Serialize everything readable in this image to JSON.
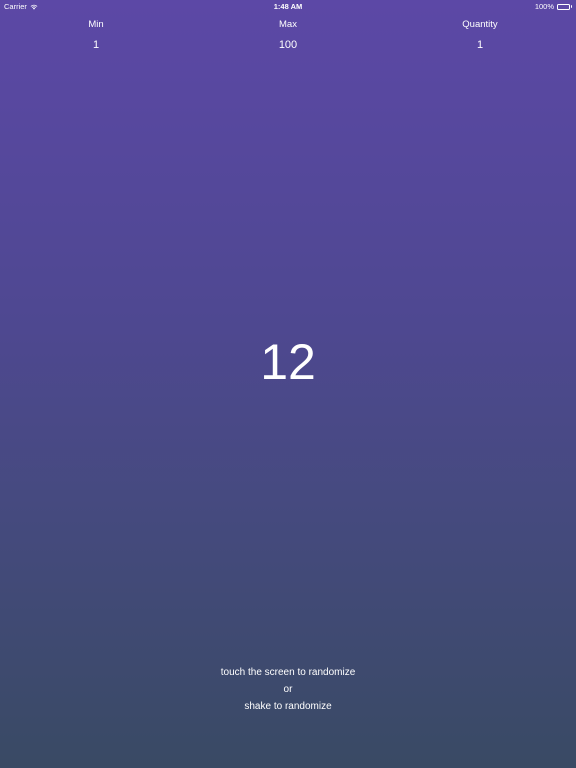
{
  "status_bar": {
    "carrier": "Carrier",
    "time": "1:48 AM",
    "battery": "100%",
    "icons": [
      "wifi-icon",
      "battery-icon"
    ]
  },
  "settings": {
    "min": {
      "label": "Min",
      "value": "1"
    },
    "max": {
      "label": "Max",
      "value": "100"
    },
    "quantity": {
      "label": "Quantity",
      "value": "1"
    }
  },
  "result": "12",
  "instructions": {
    "line1": "touch the screen to randomize",
    "line2": "or",
    "line3": "shake to randomize"
  },
  "colors": {
    "gradient_top": "#5c48a6",
    "gradient_bottom": "#394a64",
    "text": "#ffffff"
  }
}
